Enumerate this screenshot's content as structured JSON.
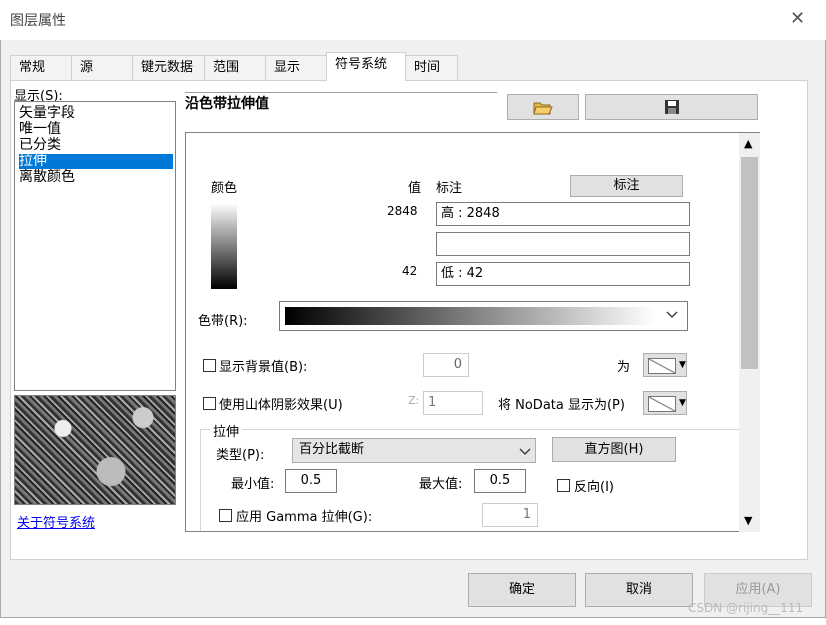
{
  "window": {
    "title": "图层属性",
    "close_glyph": "✕"
  },
  "tabs": [
    "常规",
    "源",
    "键元数据",
    "范围",
    "显示",
    "符号系统",
    "时间"
  ],
  "active_tab": "符号系统",
  "sidebar": {
    "show_label": "显示(S):",
    "items": [
      "矢量字段",
      "唯一值",
      "已分类",
      "拉伸",
      "离散颜色"
    ],
    "selected": "拉伸",
    "about_link": "关于符号系统"
  },
  "header": {
    "title": "沿色带拉伸值",
    "open_icon": "folder-open-icon",
    "save_icon": "save-icon"
  },
  "legend": {
    "color_header": "颜色",
    "value_header": "值",
    "label_header": "标注",
    "label_button": "标注",
    "high_value": "2848",
    "high_label": "高 : 2848",
    "mid_label": "",
    "low_value": "42",
    "low_label": "低 : 42"
  },
  "color_ramp": {
    "label": "色带(R):"
  },
  "background": {
    "label": "显示背景值(B):",
    "value": "0",
    "as_label": "为"
  },
  "hillshade": {
    "label": "使用山体阴影效果(U)",
    "z_label": "Z:",
    "z_value": "1",
    "nodata_label": "将 NoData 显示为(P)"
  },
  "stretch": {
    "group_label": "拉伸",
    "type_label": "类型(P):",
    "type_value": "百分比截断",
    "histogram_button": "直方图(H)",
    "min_label": "最小值:",
    "min_value": "0.5",
    "max_label": "最大值:",
    "max_value": "0.5",
    "invert_label": "反向(I)",
    "gamma_label": "应用 Gamma 拉伸(G):",
    "gamma_value": "1"
  },
  "footer": {
    "ok": "确定",
    "cancel": "取消",
    "apply": "应用(A)",
    "watermark": "CSDN @rijing__111"
  },
  "colors": {
    "selection": "#0078d7",
    "link": "#0000ee"
  }
}
